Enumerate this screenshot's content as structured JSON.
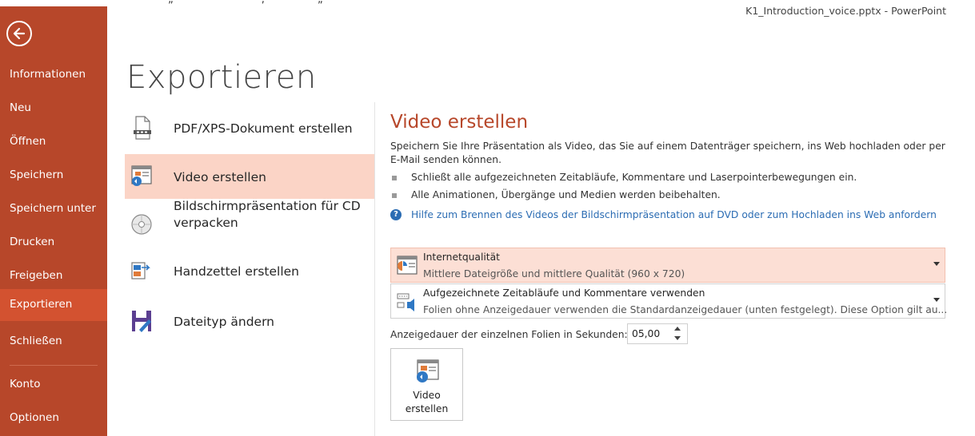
{
  "window": {
    "title": "K1_Introduction_voice.pptx - PowerPoint",
    "cut_text": "„                        “ ,                „            “"
  },
  "sidebar": {
    "items": [
      {
        "label": "Informationen"
      },
      {
        "label": "Neu"
      },
      {
        "label": "Öffnen"
      },
      {
        "label": "Speichern"
      },
      {
        "label": "Speichern unter"
      },
      {
        "label": "Drucken"
      },
      {
        "label": "Freigeben"
      },
      {
        "label": "Exportieren",
        "active": true
      },
      {
        "label": "Schließen"
      },
      {
        "label": "Konto"
      },
      {
        "label": "Optionen"
      }
    ]
  },
  "main": {
    "title": "Exportieren",
    "options": [
      {
        "label": "PDF/XPS-Dokument erstellen",
        "icon": "pdf-document-icon"
      },
      {
        "label": "Video erstellen",
        "icon": "video-icon",
        "selected": true
      },
      {
        "label": "Bildschirmpräsentation für CD verpacken",
        "icon": "cd-icon"
      },
      {
        "label": "Handzettel erstellen",
        "icon": "handout-icon"
      },
      {
        "label": "Dateityp ändern",
        "icon": "save-filetype-icon"
      }
    ]
  },
  "detail": {
    "title": "Video erstellen",
    "description": "Speichern Sie Ihre Präsentation als Video, das Sie auf einem Datenträger speichern, ins Web hochladen oder per E-Mail senden können.",
    "bullets": [
      "Schließt alle aufgezeichneten Zeitabläufe, Kommentare und Laserpointerbewegungen ein.",
      "Alle Animationen, Übergänge und Medien werden beibehalten."
    ],
    "help_link": "Hilfe zum Brennen des Videos der Bildschirmpräsentation auf DVD oder zum Hochladen ins Web anfordern",
    "quality": {
      "label": "Internetqualität",
      "sub": "Mittlere Dateigröße und mittlere Qualität (960 x 720)"
    },
    "timings": {
      "label": "Aufgezeichnete Zeitabläufe und Kommentare verwenden",
      "sub": "Folien ohne Anzeigedauer verwenden die Standardanzeigedauer (unten festgelegt). Diese Option gilt au..."
    },
    "duration_label": "Anzeigedauer der einzelnen Folien in Sekunden:",
    "duration_value": "05,00",
    "create_button": {
      "line1": "Video",
      "line2": "erstellen"
    }
  },
  "colors": {
    "sidebar": "#b7472a",
    "sidebar_active": "#d35230",
    "accent_title": "#b7472a",
    "selected_option": "#fbd4c6",
    "link": "#2b6cb3"
  }
}
